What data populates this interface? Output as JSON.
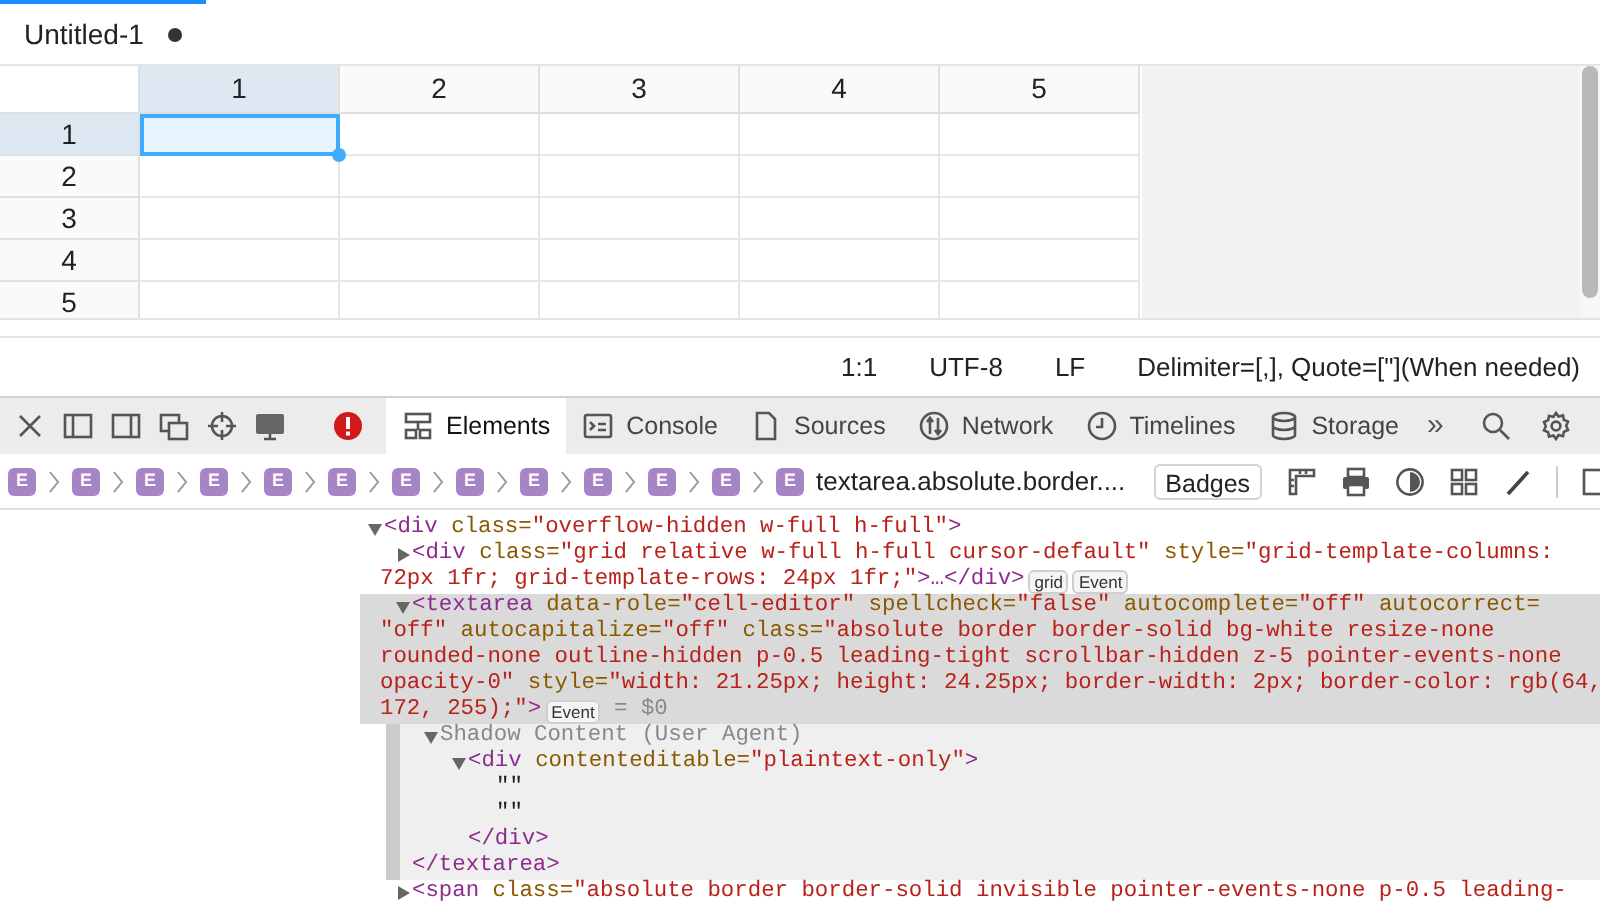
{
  "editor_tab": {
    "title": "Untitled-1",
    "modified": true,
    "selected": true
  },
  "grid": {
    "columns": [
      {
        "label": "1",
        "selected": true
      },
      {
        "label": "2",
        "selected": false
      },
      {
        "label": "3",
        "selected": false
      },
      {
        "label": "4",
        "selected": false
      },
      {
        "label": "5",
        "selected": false
      }
    ],
    "rows": [
      {
        "label": "1",
        "selected": true
      },
      {
        "label": "2",
        "selected": false
      },
      {
        "label": "3",
        "selected": false
      },
      {
        "label": "4",
        "selected": false
      },
      {
        "label": "5",
        "selected": false
      }
    ]
  },
  "status_bar": [
    "1:1",
    "UTF-8",
    "LF",
    "Delimiter=[,], Quote=[\"](When needed)"
  ],
  "devtools": {
    "tabs": [
      {
        "label": "Elements",
        "selected": true
      },
      {
        "label": "Console",
        "selected": false
      },
      {
        "label": "Sources",
        "selected": false
      },
      {
        "label": "Network",
        "selected": false
      },
      {
        "label": "Timelines",
        "selected": false
      },
      {
        "label": "Storage",
        "selected": false
      }
    ],
    "overflow": "»",
    "breadcrumbs": [
      {
        "badge": "E"
      },
      {
        "badge": "E"
      },
      {
        "badge": "E"
      },
      {
        "badge": "E"
      },
      {
        "badge": "E"
      },
      {
        "badge": "E"
      },
      {
        "badge": "E"
      },
      {
        "badge": "E"
      },
      {
        "badge": "E"
      },
      {
        "badge": "E"
      },
      {
        "badge": "E"
      },
      {
        "badge": "E"
      },
      {
        "badge": "E",
        "label": "textarea.absolute.border...."
      }
    ],
    "badges_button": "Badges",
    "dom_tree": [
      {
        "kind": "element",
        "expanded": true,
        "selected": false,
        "lines": [
          [
            {
              "kind": "tag",
              "text": "<div"
            },
            {
              "kind": "attr",
              "text": " class="
            },
            {
              "kind": "value",
              "text": "\"overflow-hidden w-full h-full\""
            },
            {
              "kind": "tag",
              "text": ">"
            }
          ]
        ],
        "children": [
          {
            "kind": "element",
            "expanded": false,
            "selected": false,
            "lines": [
              [
                {
                  "kind": "tag",
                  "text": "<div"
                },
                {
                  "kind": "attr",
                  "text": " class="
                },
                {
                  "kind": "value",
                  "text": "\"grid relative w-full h-full cursor-default\""
                },
                {
                  "kind": "attr",
                  "text": " style="
                },
                {
                  "kind": "value",
                  "text": "\"grid-template-columns:"
                }
              ],
              [
                {
                  "kind": "value",
                  "text": "72px 1fr; grid-template-rows: 24px 1fr;\""
                },
                {
                  "kind": "tag",
                  "text": ">…</div>"
                },
                {
                  "kind": "badge",
                  "text": "grid"
                },
                {
                  "kind": "badge",
                  "text": "Event"
                }
              ]
            ]
          },
          {
            "kind": "element",
            "expanded": true,
            "selected": true,
            "closing": "</textarea>",
            "lines": [
              [
                {
                  "kind": "tag",
                  "text": "<textarea"
                },
                {
                  "kind": "attr",
                  "text": " data-role="
                },
                {
                  "kind": "value",
                  "text": "\"cell-editor\""
                },
                {
                  "kind": "attr",
                  "text": " spellcheck="
                },
                {
                  "kind": "value",
                  "text": "\"false\""
                },
                {
                  "kind": "attr",
                  "text": " autocomplete="
                },
                {
                  "kind": "value",
                  "text": "\"off\""
                },
                {
                  "kind": "attr",
                  "text": " autocorrect="
                }
              ],
              [
                {
                  "kind": "value",
                  "text": "\"off\""
                },
                {
                  "kind": "attr",
                  "text": " autocapitalize="
                },
                {
                  "kind": "value",
                  "text": "\"off\""
                },
                {
                  "kind": "attr",
                  "text": " class="
                },
                {
                  "kind": "value",
                  "text": "\"absolute border border-solid bg-white resize-none"
                }
              ],
              [
                {
                  "kind": "value",
                  "text": "rounded-none outline-hidden p-0.5 leading-tight scrollbar-hidden z-5 pointer-events-none"
                }
              ],
              [
                {
                  "kind": "value",
                  "text": "opacity-0\""
                },
                {
                  "kind": "attr",
                  "text": " style="
                },
                {
                  "kind": "value",
                  "text": "\"width: 21.25px; height: 24.25px; border-width: 2px; border-color: rgb(64,"
                }
              ],
              [
                {
                  "kind": "value",
                  "text": "172, 255);\""
                },
                {
                  "kind": "tag",
                  "text": ">"
                },
                {
                  "kind": "badge",
                  "text": "Event"
                },
                {
                  "kind": "note",
                  "text": " = $0"
                }
              ]
            ],
            "children": [
              {
                "kind": "shadow",
                "expanded": true,
                "selected": false,
                "lines": [
                  [
                    {
                      "kind": "note",
                      "text": "Shadow Content (User Agent)"
                    }
                  ]
                ],
                "children": [
                  {
                    "kind": "element",
                    "expanded": true,
                    "selected": false,
                    "closing": "</div>",
                    "lines": [
                      [
                        {
                          "kind": "tag",
                          "text": "<div"
                        },
                        {
                          "kind": "attr",
                          "text": " contenteditable="
                        },
                        {
                          "kind": "value",
                          "text": "\"plaintext-only\""
                        },
                        {
                          "kind": "tag",
                          "text": ">"
                        }
                      ]
                    ],
                    "children": [
                      {
                        "kind": "text",
                        "selected": false,
                        "lines": [
                          [
                            {
                              "kind": "plain",
                              "text": "\"\""
                            }
                          ]
                        ]
                      },
                      {
                        "kind": "text",
                        "selected": false,
                        "lines": [
                          [
                            {
                              "kind": "plain",
                              "text": "\"\""
                            }
                          ]
                        ]
                      }
                    ]
                  }
                ]
              }
            ]
          },
          {
            "kind": "element",
            "expanded": false,
            "selected": false,
            "lines": [
              [
                {
                  "kind": "tag",
                  "text": "<span"
                },
                {
                  "kind": "attr",
                  "text": " class="
                },
                {
                  "kind": "value",
                  "text": "\"absolute border border-solid invisible pointer-events-none p-0.5 leading-"
                }
              ]
            ]
          }
        ]
      }
    ]
  }
}
